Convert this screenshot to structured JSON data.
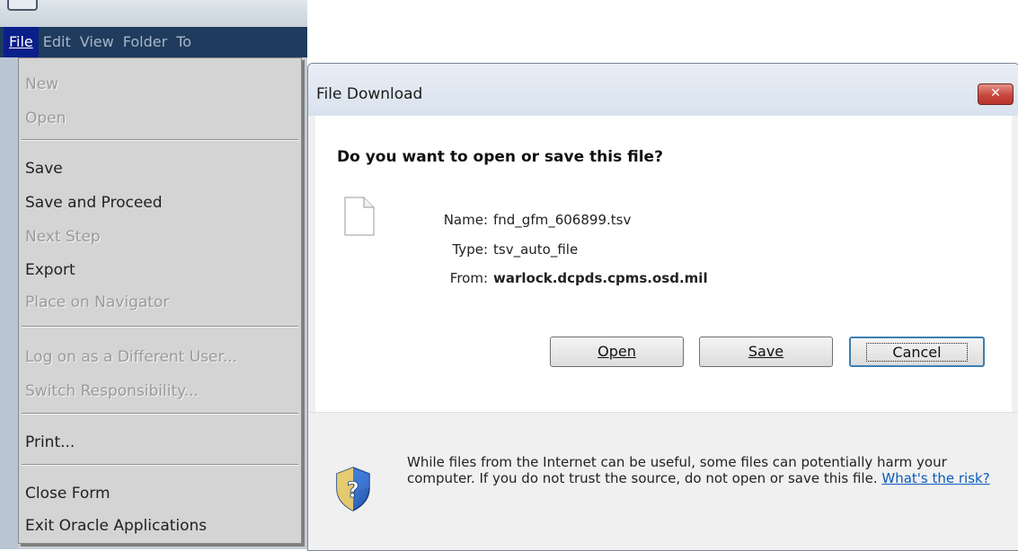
{
  "oracle_app": {
    "menubar": {
      "file": "File",
      "edit": "Edit",
      "view": "View",
      "folder": "Folder",
      "tools": "To"
    },
    "file_menu": {
      "new": "New",
      "open": "Open",
      "save": "Save",
      "save_and_proceed": "Save and Proceed",
      "next_step": "Next Step",
      "export": "Export",
      "place_on_navigator": "Place on Navigator",
      "log_on": "Log on as a Different User...",
      "switch_responsibility": "Switch Responsibility...",
      "print": "Print...",
      "close_form": "Close Form",
      "exit": "Exit Oracle Applications"
    }
  },
  "dialog": {
    "title": "File Download",
    "close_glyph": "✕",
    "question": "Do you want to open or save this file?",
    "info": {
      "name_label": "Name:",
      "name_value": "fnd_gfm_606899.tsv",
      "type_label": "Type:",
      "type_value": "tsv_auto_file",
      "from_label": "From:",
      "from_value": "warlock.dcpds.cpms.osd.mil"
    },
    "buttons": {
      "open": "Open",
      "save": "Save",
      "cancel": "Cancel"
    },
    "warning": "While files from the Internet can be useful, some files can potentially harm your computer. If you do not trust the source, do not open or save this file.",
    "risk_link": "What's the risk?"
  },
  "colors": {
    "menubar_bg": "#1f3b5e",
    "menu_active_bg": "#0a1f8a",
    "menu_bg": "#d4d4d4",
    "disabled_text": "#9a9a9a",
    "close_button": "#c8473d",
    "link": "#0a5bbd"
  },
  "icons": {
    "file": "file-icon",
    "security": "shield-question-icon",
    "close": "close-icon"
  }
}
